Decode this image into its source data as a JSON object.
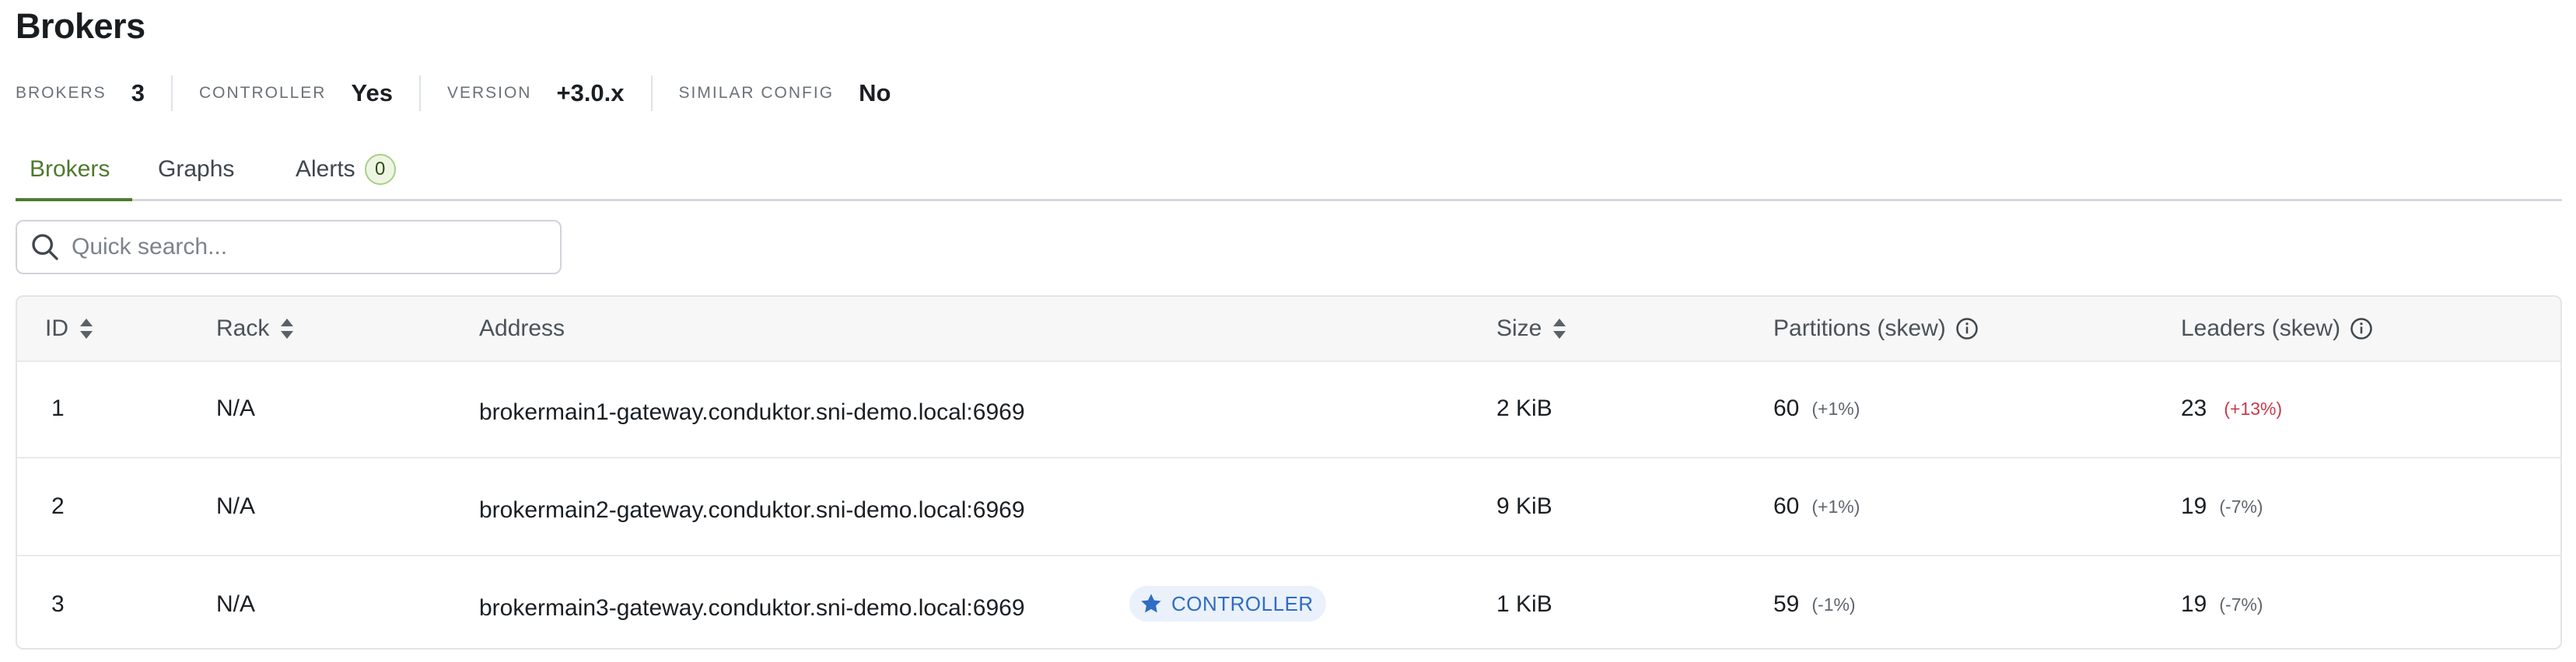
{
  "page": {
    "title": "Brokers"
  },
  "stats": [
    {
      "label": "BROKERS",
      "value": "3"
    },
    {
      "label": "CONTROLLER",
      "value": "Yes"
    },
    {
      "label": "VERSION",
      "value": "+3.0.x"
    },
    {
      "label": "SIMILAR CONFIG",
      "value": "No"
    }
  ],
  "tabs": [
    {
      "label": "Brokers",
      "active": true
    },
    {
      "label": "Graphs",
      "active": false
    },
    {
      "label": "Alerts",
      "active": false,
      "badge": "0"
    }
  ],
  "search": {
    "placeholder": "Quick search..."
  },
  "table": {
    "columns": [
      "ID",
      "Rack",
      "Address",
      "Size",
      "Partitions (skew)",
      "Leaders (skew)"
    ],
    "rows": [
      {
        "id": "1",
        "rack": "N/A",
        "address": "brokermain1-gateway.conduktor.sni-demo.local:6969",
        "badge": "",
        "size": "2 KiB",
        "partitions": "60",
        "partitions_skew": "(+1%)",
        "leaders": "23",
        "leaders_skew": "(+13%)"
      },
      {
        "id": "2",
        "rack": "N/A",
        "address": "brokermain2-gateway.conduktor.sni-demo.local:6969",
        "badge": "",
        "size": "9 KiB",
        "partitions": "60",
        "partitions_skew": "(+1%)",
        "leaders": "19",
        "leaders_skew": "(-7%)"
      },
      {
        "id": "3",
        "rack": "N/A",
        "address": "brokermain3-gateway.conduktor.sni-demo.local:6969",
        "badge": "CONTROLLER",
        "size": "1 KiB",
        "partitions": "59",
        "partitions_skew": "(-1%)",
        "leaders": "19",
        "leaders_skew": "(-7%)"
      }
    ]
  },
  "colors": {
    "accent": "#4f7a2e",
    "warning": "#c83a4c",
    "controller": "#2f6dc4"
  },
  "icons": {
    "search": "search-icon",
    "sort": "sort-icon",
    "info": "info-icon",
    "controller": "star-icon"
  }
}
